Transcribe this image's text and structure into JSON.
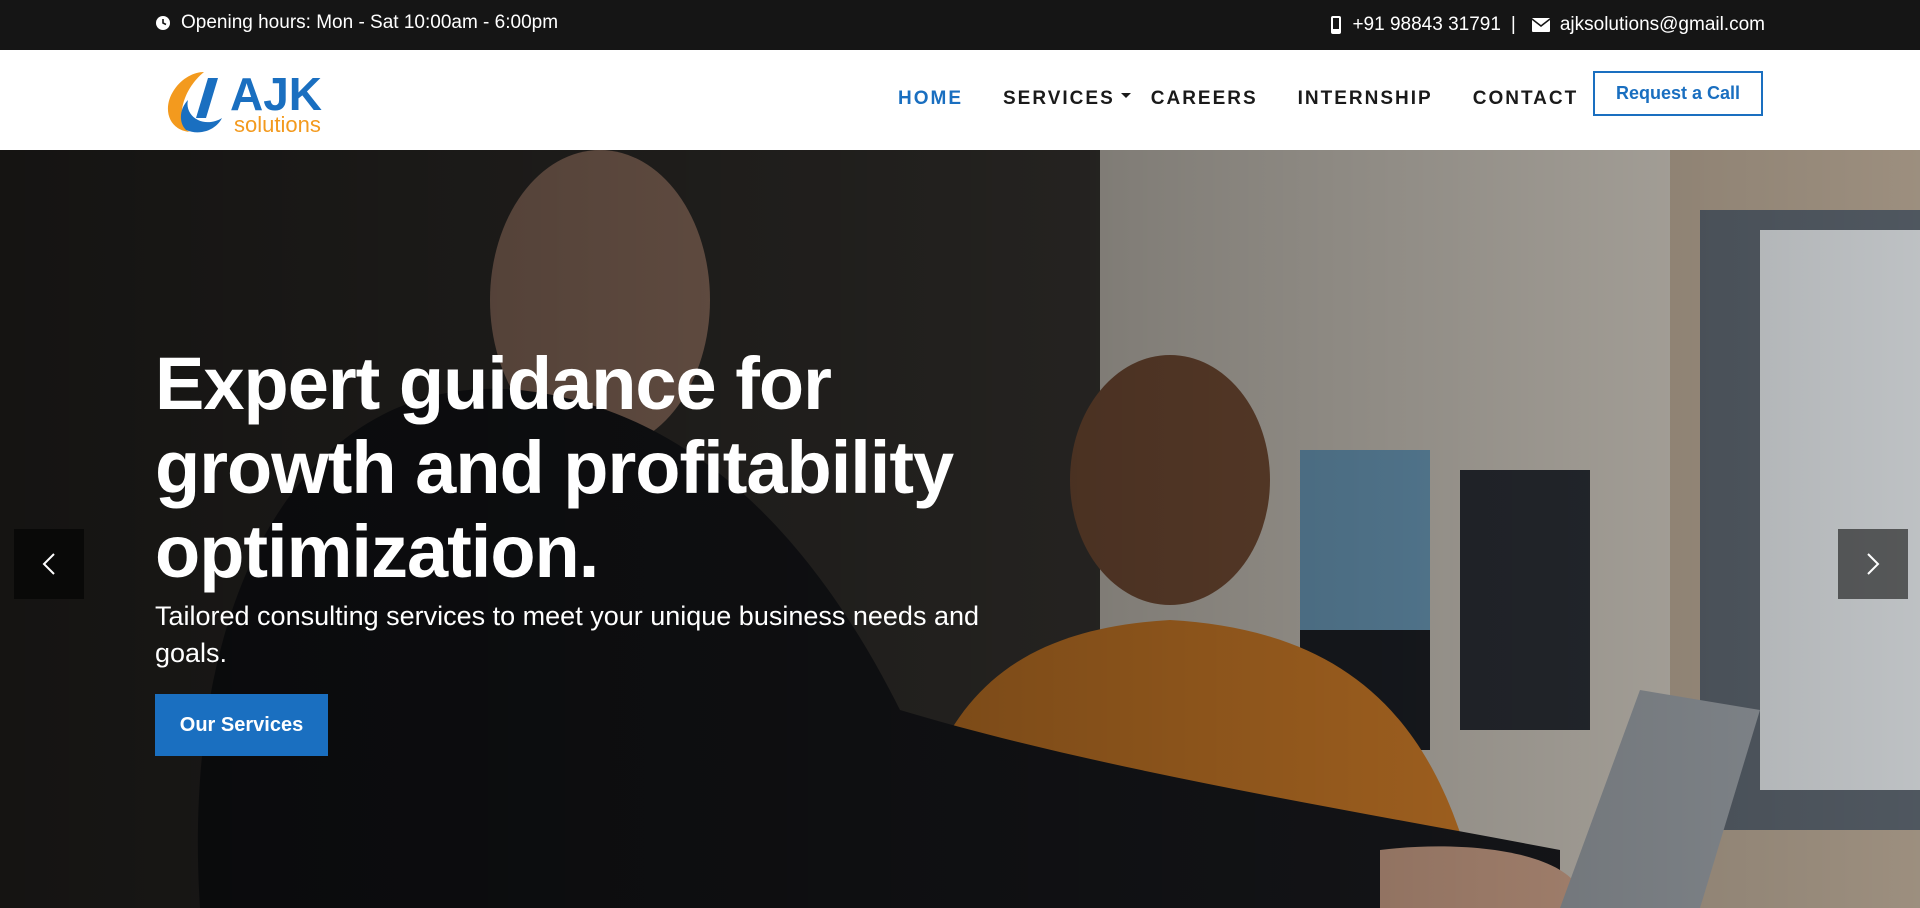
{
  "topbar": {
    "hours": "Opening hours: Mon - Sat 10:00am - 6:00pm",
    "phone": "+91 98843 31791",
    "separator": "|",
    "email": "ajksolutions@gmail.com",
    "icons": [
      "clock-icon",
      "phone-icon",
      "mail-icon"
    ]
  },
  "brand": {
    "name": "AJK",
    "tagline": "solutions",
    "colors": {
      "blue": "#1a6fc0",
      "orange": "#f39a1e"
    }
  },
  "nav": {
    "items": [
      {
        "label": "HOME",
        "active": true
      },
      {
        "label": "SERVICES",
        "has_dropdown": true
      },
      {
        "label": "CAREERS"
      },
      {
        "label": "INTERNSHIP"
      },
      {
        "label": "CONTACT"
      }
    ],
    "cta": "Request a Call"
  },
  "hero": {
    "title": "Expert guidance for growth and profitability optimization.",
    "subtitle": "Tailored consulting services to meet your unique business needs and goals.",
    "button": "Our Services",
    "prev_icon": "chevron-left-icon",
    "next_icon": "chevron-right-icon"
  },
  "colors": {
    "accent": "#1a6fc0",
    "topbar_bg": "#151515"
  }
}
